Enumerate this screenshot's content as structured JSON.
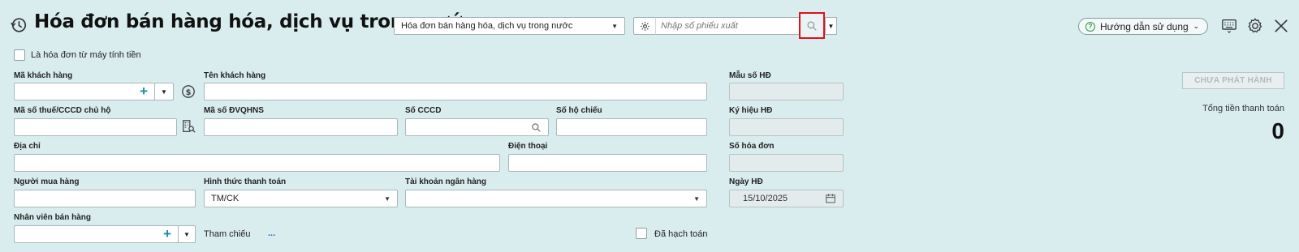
{
  "header": {
    "title": "Hóa đơn bán hàng hóa, dịch vụ trong nước",
    "invoice_type_selected": "Hóa đơn bán hàng hóa, dịch vụ trong nước",
    "search_placeholder": "Nhập số phiếu xuất",
    "help_label": "Hướng dẫn sử dụng"
  },
  "form": {
    "cash_register_label": "Là hóa đơn từ máy tính tiền",
    "customer_code_label": "Mã khách hàng",
    "customer_name_label": "Tên khách hàng",
    "tax_code_label": "Mã số thuế/CCCD chủ hộ",
    "budget_code_label": "Mã số ĐVQHNS",
    "id_card_label": "Số CCCD",
    "passport_label": "Số hộ chiếu",
    "address_label": "Địa chỉ",
    "phone_label": "Điện thoại",
    "buyer_label": "Người mua hàng",
    "payment_method_label": "Hình thức thanh toán",
    "payment_method_value": "TM/CK",
    "bank_account_label": "Tài khoản ngân hàng",
    "salesperson_label": "Nhân viên bán hàng",
    "reference_label": "Tham chiếu",
    "reference_value": "...",
    "posted_label": "Đã hạch toán"
  },
  "invoice_info": {
    "template_label": "Mẫu số HĐ",
    "symbol_label": "Ký hiệu HĐ",
    "number_label": "Số hóa đơn",
    "date_label": "Ngày HĐ",
    "date_value": "15/10/2025"
  },
  "summary": {
    "status": "CHƯA PHÁT HÀNH",
    "total_label": "Tổng tiền thanh toán",
    "total_value": "0"
  },
  "colors": {
    "background": "#d9ecee",
    "highlight": "#e0121b",
    "accent": "#1a8f9e"
  },
  "icons": [
    "history-icon",
    "gear-icon",
    "search-icon",
    "chevron-down-icon",
    "help-icon",
    "keyboard-icon",
    "settings-icon",
    "close-icon",
    "plus-icon",
    "dollar-icon",
    "lookup-icon",
    "calendar-icon"
  ]
}
